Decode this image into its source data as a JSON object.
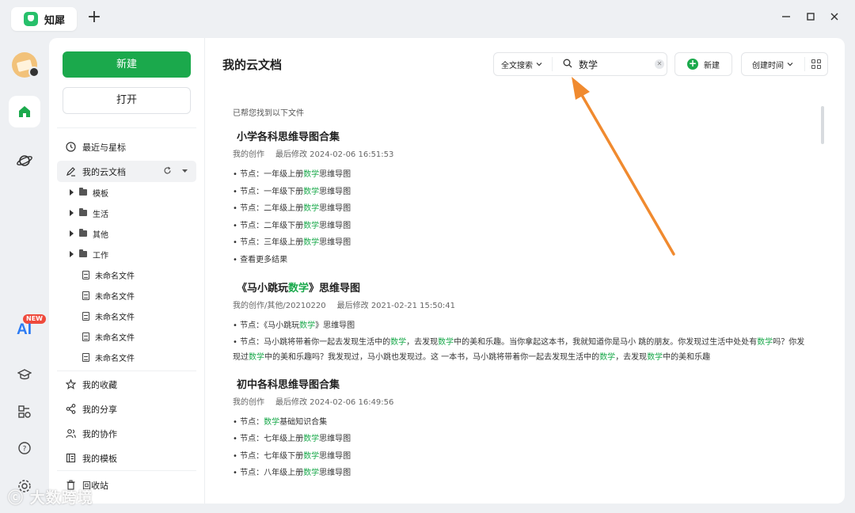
{
  "app": {
    "name": "知犀"
  },
  "window": {
    "new_tab": "+",
    "minimize": "—",
    "maximize": "□",
    "close": "×"
  },
  "rail": {
    "ai_label": "AI",
    "new_badge": "NEW"
  },
  "sidebar": {
    "new_button": "新建",
    "open_button": "打开",
    "nav": [
      {
        "label": "最近与星标"
      },
      {
        "label": "我的云文档"
      }
    ],
    "tree": [
      {
        "label": "模板"
      },
      {
        "label": "生活"
      },
      {
        "label": "其他"
      },
      {
        "label": "工作"
      },
      {
        "label": "未命名文件"
      },
      {
        "label": "未命名文件"
      },
      {
        "label": "未命名文件"
      },
      {
        "label": "未命名文件"
      },
      {
        "label": "未命名文件"
      }
    ],
    "bottom": [
      {
        "label": "我的收藏"
      },
      {
        "label": "我的分享"
      },
      {
        "label": "我的协作"
      },
      {
        "label": "我的模板"
      },
      {
        "label": "回收站"
      }
    ]
  },
  "main": {
    "title": "我的云文档",
    "search_scope": "全文搜索",
    "search_value": "数学",
    "new_button": "新建",
    "sort_label": "创建时间",
    "found_note": "已帮您找到以下文件",
    "results": [
      {
        "title": "小学各科思维导图合集",
        "path": "我的创作",
        "modified": "最后修改 2024-02-06 16:51:53",
        "lines": [
          {
            "pre": "• 节点：一年级上册",
            "hl": "数学",
            "post": "思维导图"
          },
          {
            "pre": "• 节点：一年级下册",
            "hl": "数学",
            "post": "思维导图"
          },
          {
            "pre": "• 节点：二年级上册",
            "hl": "数学",
            "post": "思维导图"
          },
          {
            "pre": "• 节点：二年级下册",
            "hl": "数学",
            "post": "思维导图"
          },
          {
            "pre": "• 节点：三年级上册",
            "hl": "数学",
            "post": "思维导图"
          },
          {
            "pre": "• 查看更多结果",
            "hl": "",
            "post": ""
          }
        ]
      },
      {
        "title_pre": "《马小跳玩",
        "title_hl": "数学",
        "title_post": "》思维导图",
        "path": "我的创作/其他/20210220",
        "modified": "最后修改 2021-02-21 15:50:41",
        "line1_pre": "• 节点：《马小跳玩",
        "line1_hl": "数学",
        "line1_post": "》思维导图",
        "para": [
          "• 节点：马小跳将带着你一起去发现生活中的",
          "数学",
          "，去发现",
          "数学",
          "中的美和乐趣。当你拿起这本书，我就知道你是马小 跳的朋友。你发现过生活中处处有",
          "数学",
          "吗？你发现过",
          "数学",
          "中的美和乐趣吗？我发现过，马小跳也发现过。这 一本书，马小跳将带着你一起去发现生活中的",
          "数学",
          "，去发现",
          "数学",
          "中的美和乐趣"
        ]
      },
      {
        "title": "初中各科思维导图合集",
        "path": "我的创作",
        "modified": "最后修改 2024-02-06 16:49:56",
        "lines": [
          {
            "pre": "• 节点：",
            "hl": "数学",
            "post": "基础知识合集"
          },
          {
            "pre": "• 节点：七年级上册",
            "hl": "数学",
            "post": "思维导图"
          },
          {
            "pre": "• 节点：七年级下册",
            "hl": "数学",
            "post": "思维导图"
          },
          {
            "pre": "• 节点：八年级上册",
            "hl": "数学",
            "post": "思维导图"
          }
        ]
      }
    ]
  },
  "watermark": "大数跨境",
  "colors": {
    "brand_green": "#1ba94c",
    "arrow": "#f08a2f",
    "ai_blue": "#2c7bf3"
  }
}
